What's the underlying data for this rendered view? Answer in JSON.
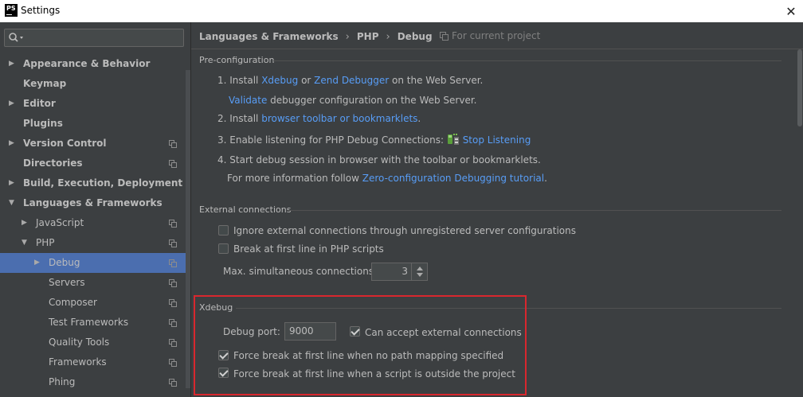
{
  "window": {
    "title": "Settings",
    "app_icon_text": "PS",
    "close_label": "✕"
  },
  "sidebar": {
    "search": {
      "placeholder": ""
    },
    "items": [
      {
        "label": "Appearance & Behavior",
        "level": 0,
        "arrow": "▶",
        "project_icon": false
      },
      {
        "label": "Keymap",
        "level": 0,
        "arrow": "",
        "project_icon": false
      },
      {
        "label": "Editor",
        "level": 0,
        "arrow": "▶",
        "project_icon": false
      },
      {
        "label": "Plugins",
        "level": 0,
        "arrow": "",
        "project_icon": false
      },
      {
        "label": "Version Control",
        "level": 0,
        "arrow": "▶",
        "project_icon": true
      },
      {
        "label": "Directories",
        "level": 0,
        "arrow": "",
        "project_icon": true
      },
      {
        "label": "Build, Execution, Deployment",
        "level": 0,
        "arrow": "▶",
        "project_icon": false
      },
      {
        "label": "Languages & Frameworks",
        "level": 0,
        "arrow": "▼",
        "project_icon": false
      },
      {
        "label": "JavaScript",
        "level": 1,
        "arrow": "▶",
        "project_icon": true
      },
      {
        "label": "PHP",
        "level": 1,
        "arrow": "▼",
        "project_icon": true
      },
      {
        "label": "Debug",
        "level": 2,
        "arrow": "▶",
        "project_icon": true,
        "selected": true
      },
      {
        "label": "Servers",
        "level": 2,
        "arrow": "",
        "project_icon": true
      },
      {
        "label": "Composer",
        "level": 2,
        "arrow": "",
        "project_icon": true
      },
      {
        "label": "Test Frameworks",
        "level": 2,
        "arrow": "",
        "project_icon": true
      },
      {
        "label": "Quality Tools",
        "level": 2,
        "arrow": "",
        "project_icon": true
      },
      {
        "label": "Frameworks",
        "level": 2,
        "arrow": "",
        "project_icon": true
      },
      {
        "label": "Phing",
        "level": 2,
        "arrow": "",
        "project_icon": true
      }
    ]
  },
  "header": {
    "breadcrumb": [
      "Languages & Frameworks",
      "PHP",
      "Debug"
    ],
    "separator": "›",
    "for_current_project": "For current project"
  },
  "preconfig": {
    "title": "Pre-configuration",
    "step1_prefix": "1. Install ",
    "step1_link1": "Xdebug",
    "step1_or": " or ",
    "step1_link2": "Zend Debugger",
    "step1_suffix": " on the Web Server.",
    "validate_link": "Validate",
    "validate_suffix": " debugger configuration on the Web Server.",
    "step2_prefix": "2. Install ",
    "step2_link": "browser toolbar or bookmarklets",
    "step2_suffix": ".",
    "step3_prefix": "3. Enable listening for PHP Debug Connections: ",
    "step3_link": "Stop Listening",
    "step4": "4. Start debug session in browser with the toolbar or bookmarklets.",
    "more_prefix": "For more information follow ",
    "more_link": "Zero-configuration Debugging tutorial",
    "more_suffix": "."
  },
  "external": {
    "title": "External connections",
    "ignore_label": "Ignore external connections through unregistered server configurations",
    "ignore_checked": false,
    "break_label": "Break at first line in PHP scripts",
    "break_checked": false,
    "max_label": "Max. simultaneous connections:",
    "max_value": "3"
  },
  "xdebug": {
    "title": "Xdebug",
    "port_label": "Debug port:",
    "port_value": "9000",
    "accept_label": "Can accept external connections",
    "accept_checked": true,
    "force_no_mapping_label": "Force break at first line when no path mapping specified",
    "force_no_mapping_checked": true,
    "force_outside_label": "Force break at first line when a script is outside the project",
    "force_outside_checked": true
  },
  "colors": {
    "background": "#3c3f41",
    "selection": "#4b6eaf",
    "link": "#589df6",
    "highlight_border": "#d9272e"
  }
}
